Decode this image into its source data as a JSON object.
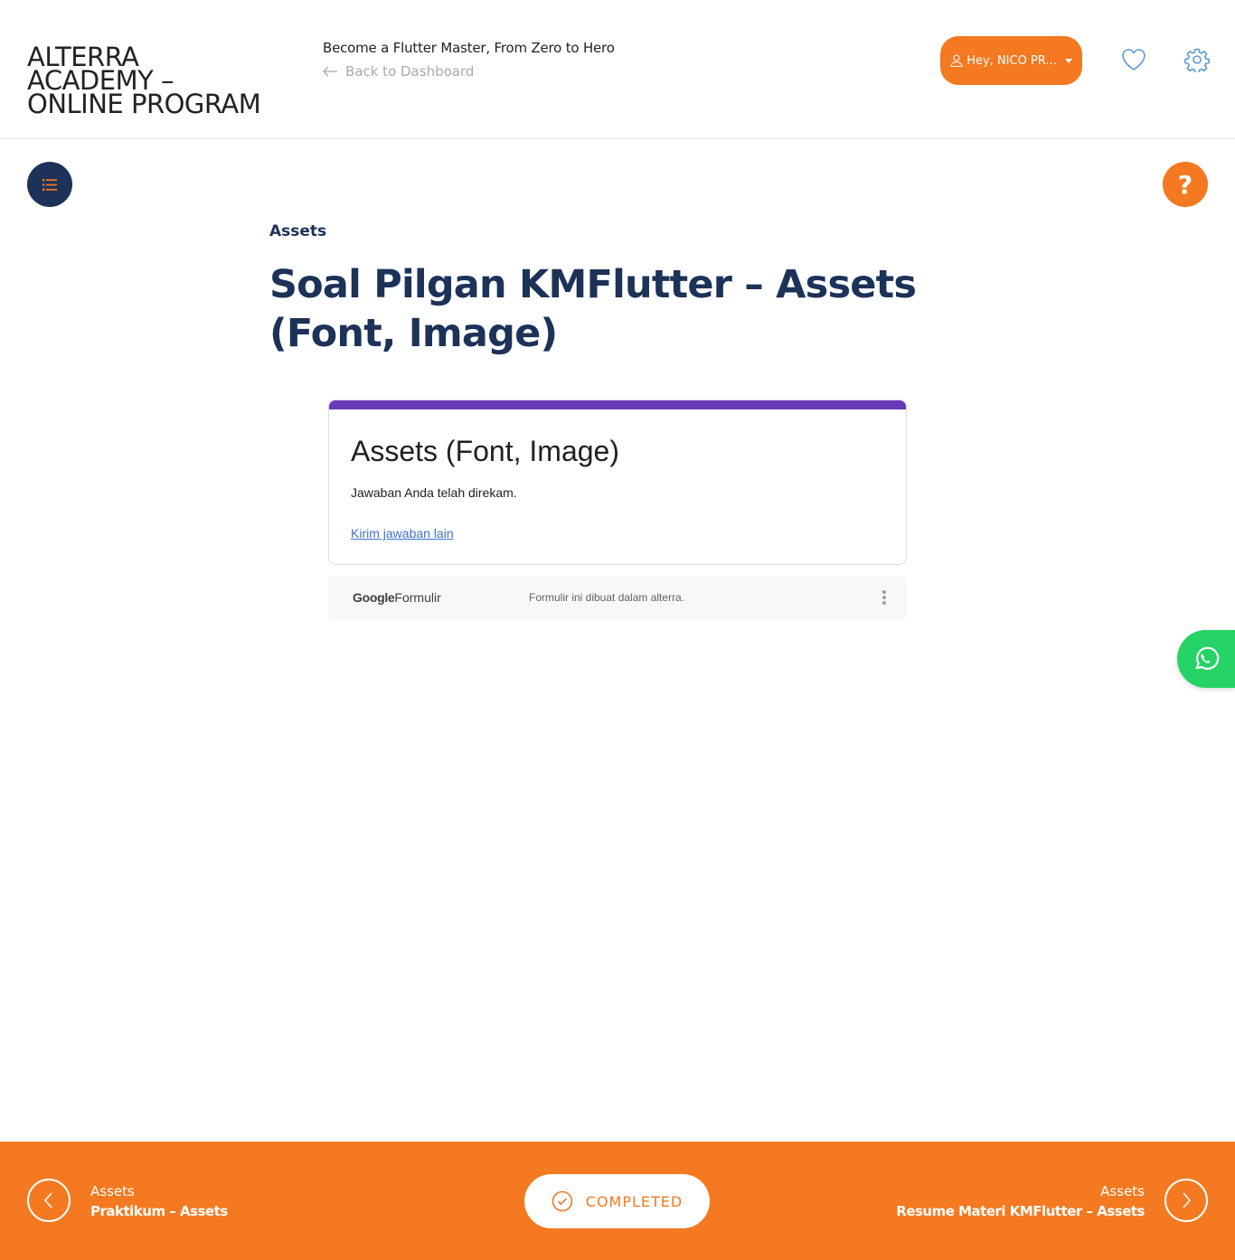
{
  "header": {
    "logo_line1": "ALTERRA",
    "logo_line2": "ACADEMY –",
    "logo_line3": "ONLINE PROGRAM",
    "course_title": "Become a Flutter Master, From Zero to Hero",
    "back_label": "Back to Dashboard",
    "user_label": "Hey, NICO PR...",
    "icons": [
      "user-icon",
      "heart-icon",
      "gear-icon"
    ]
  },
  "lesson": {
    "section": "Assets",
    "title": "Soal Pilgan KMFlutter – Assets (Font, Image)"
  },
  "form": {
    "title": "Assets (Font, Image)",
    "message": "Jawaban Anda telah direkam.",
    "link": "Kirim jawaban lain",
    "brand_google": "Google",
    "brand_formulir": "Formulir",
    "note": "Formulir ini dibuat dalam alterra."
  },
  "footer_nav": {
    "prev_section": "Assets",
    "prev_title": "Praktikum – Assets",
    "completed_label": "COMPLETED",
    "next_section": "Assets",
    "next_title": "Resume Materi KMFlutter – Assets"
  },
  "colors": {
    "accent": "#f47920",
    "navy": "#1c3258",
    "form_bar": "#673ab7",
    "whatsapp": "#25d366"
  }
}
